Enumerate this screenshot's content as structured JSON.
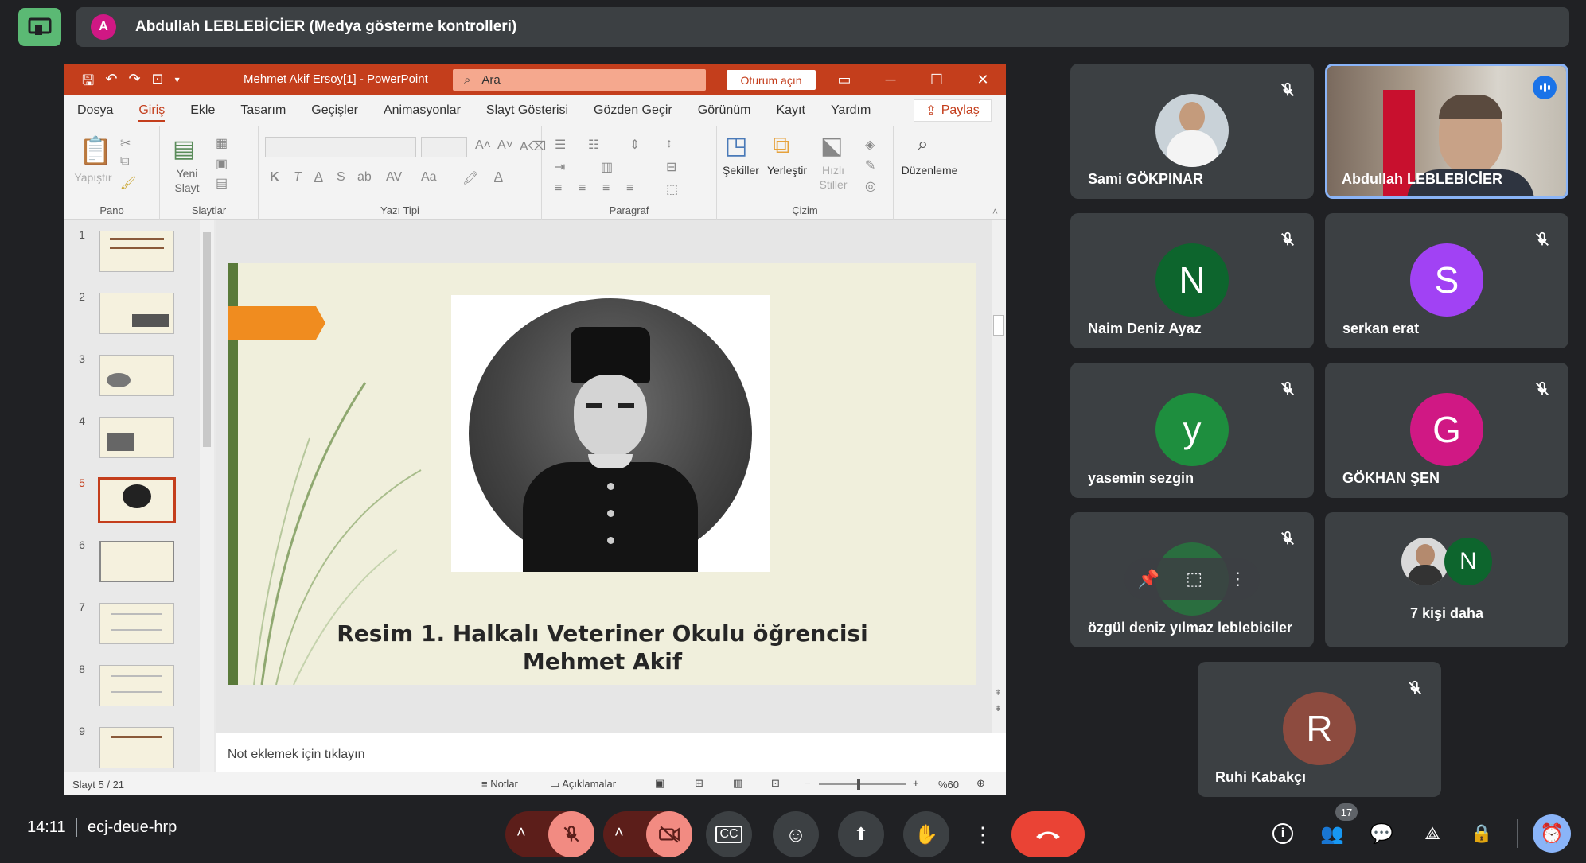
{
  "banner": {
    "avatar_letter": "A",
    "title": "Abdullah LEBLEBİCİER (Medya gösterme kontrolleri)"
  },
  "ppt": {
    "doc_title": "Mehmet Akif Ersoy[1]  -  PowerPoint",
    "search_placeholder": "Ara",
    "signin_label": "Oturum açın",
    "tabs": [
      "Dosya",
      "Giriş",
      "Ekle",
      "Tasarım",
      "Geçişler",
      "Animasyonlar",
      "Slayt Gösterisi",
      "Gözden Geçir",
      "Görünüm",
      "Kayıt",
      "Yardım"
    ],
    "active_tab": "Giriş",
    "share_label": "Paylaş",
    "ribbon": {
      "pano": "Pano",
      "paste": "Yapıştır",
      "slaytlar": "Slaytlar",
      "new_slide_1": "Yeni",
      "new_slide_2": "Slayt",
      "font": "Yazı Tipi",
      "paragraph": "Paragraf",
      "drawing": "Çizim",
      "shapes": "Şekiller",
      "arrange": "Yerleştir",
      "quick_1": "Hızlı",
      "quick_2": "Stiller",
      "editing": "Düzenleme"
    },
    "slide_numbers": [
      "1",
      "2",
      "3",
      "4",
      "5",
      "6",
      "7",
      "8",
      "9"
    ],
    "selected_slide": 5,
    "slide": {
      "caption_1": "Resim 1. Halkalı Veteriner Okulu öğrencisi",
      "caption_2": "Mehmet Akif"
    },
    "notes_placeholder": "Not eklemek için tıklayın",
    "status": {
      "slide_count": "Slayt 5 / 21",
      "notes": "Notlar",
      "comments": "Açıklamalar",
      "zoom": "%60"
    }
  },
  "participants": [
    {
      "name": "Sami GÖKPINAR",
      "type": "photo"
    },
    {
      "name": "Abdullah LEBLEBİCİER",
      "type": "video",
      "speaking": true
    },
    {
      "name": "Naim Deniz Ayaz",
      "initial": "N",
      "color": "#0d652d"
    },
    {
      "name": "serkan erat",
      "initial": "S",
      "color": "#a142f4"
    },
    {
      "name": "yasemin sezgin",
      "initial": "y",
      "color": "#1e8e3e"
    },
    {
      "name": "GÖKHAN ŞEN",
      "initial": "G",
      "color": "#d01884"
    },
    {
      "name": "özgül deniz yılmaz leblebiciler",
      "type": "hover"
    },
    {
      "name": "7 kişi daha",
      "initial": "N",
      "color": "#0d652d"
    },
    {
      "name": "Ruhi Kabakçı",
      "initial": "R",
      "color": "#8d4b3f"
    }
  ],
  "bottom": {
    "time": "14:11",
    "meeting_code": "ecj-deue-hrp",
    "participant_count": "17"
  },
  "colors": {
    "accent": "#c43e1c",
    "end_call": "#ea4335",
    "muted": "#f28b82"
  }
}
